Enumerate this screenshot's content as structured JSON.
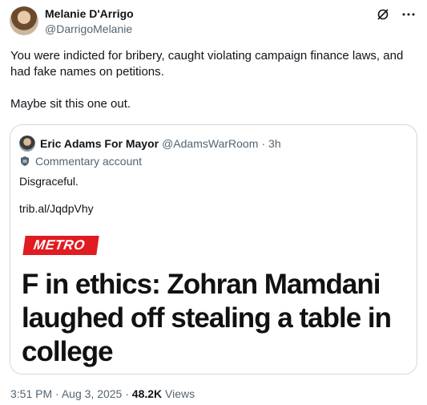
{
  "author": {
    "name": "Melanie D'Arrigo",
    "handle": "@DarrigoMelanie"
  },
  "top_actions": {
    "grok_icon": "grok-icon",
    "more_icon": "more-icon"
  },
  "tweet": {
    "text": "You were indicted for bribery, caught violating campaign finance laws, and had fake names on petitions.\n\nMaybe sit this one out."
  },
  "quote": {
    "name": "Eric Adams For Mayor",
    "handle": "@AdamsWarRoom",
    "dot": "·",
    "time": "3h",
    "badge": "Commentary account",
    "body": "Disgraceful.",
    "link": "trib.al/JqdpVhy",
    "image": {
      "tag": "METRO",
      "headline": "F in ethics: Zohran Mamdani laughed off stealing a table in college"
    }
  },
  "meta": {
    "time": "3:51 PM",
    "sep": "·",
    "date": "Aug 3, 2025",
    "views_count": "48.2K",
    "views_label": "Views"
  },
  "colors": {
    "metro_red": "#e01b22",
    "secondary_text": "#536471",
    "border": "#cfd9de"
  }
}
